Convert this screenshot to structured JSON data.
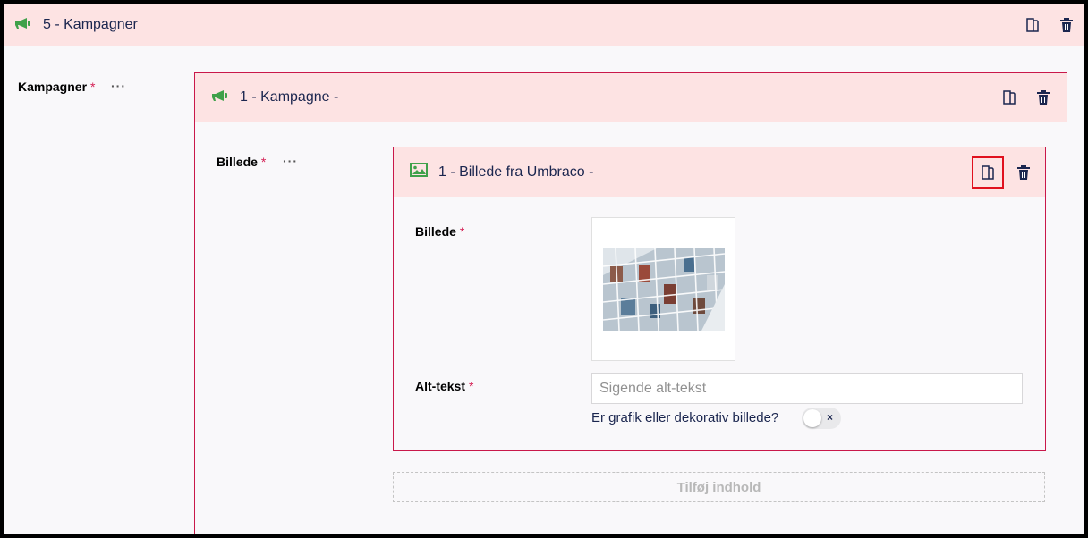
{
  "level1": {
    "title": "5 - Kampagner",
    "field_label": "Kampagner",
    "required_mark": "*",
    "more": "···",
    "icon": "megaphone-icon"
  },
  "level2": {
    "title": "1 - Kampagne -",
    "field_label": "Billede",
    "required_mark": "*",
    "more": "···",
    "icon": "megaphone-icon"
  },
  "level3": {
    "title": "1 - Billede fra Umbraco -",
    "icon": "picture-icon",
    "image_label": "Billede",
    "alt_label": "Alt-tekst",
    "required_mark": "*",
    "alt_placeholder": "Sigende alt-tekst",
    "alt_value": "",
    "decorative_label": "Er grafik eller dekorativ billede?",
    "decorative_toggle_mark": "×",
    "decorative_on": false
  },
  "add_content_label": "Tilføj indhold",
  "colors": {
    "header_bg": "#fde3e3",
    "border_accent": "#c9184a",
    "icon_green": "#3fa14a",
    "highlight_red": "#e0101e"
  }
}
